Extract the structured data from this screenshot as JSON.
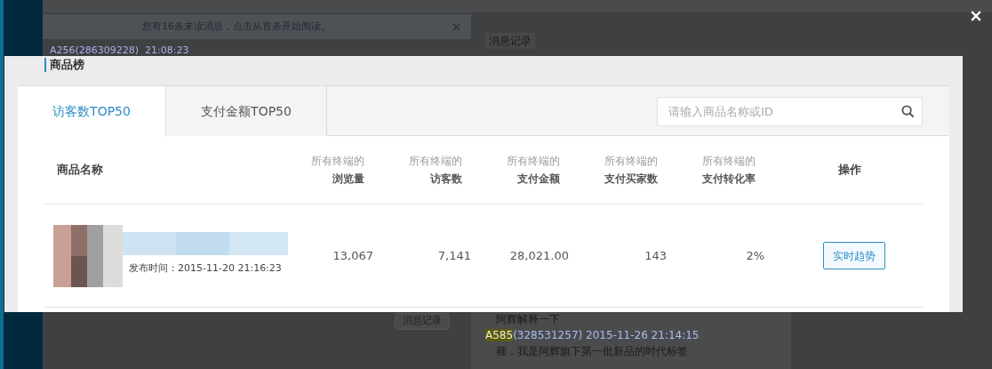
{
  "background": {
    "notice": "您有16条未读消息，点击从首条开始阅读。",
    "message_header": {
      "sender": "A256",
      "id": "(286309228)",
      "time": "21:08:23"
    },
    "side_tab": "消息记录",
    "history_button": "消息记录",
    "chat": [
      {
        "kind": "text",
        "text": "阿辉解释一下"
      },
      {
        "kind": "header",
        "sender": "A585",
        "id": "(328531257)",
        "time": "2015-11-26 21:14:15"
      },
      {
        "kind": "text",
        "text": "额，我是阿辉旗下第一批新品的时代标签"
      }
    ]
  },
  "modal": {
    "title": "商品榜",
    "tabs": [
      {
        "label": "访客数TOP50",
        "selected": true
      },
      {
        "label": "支付金额TOP50",
        "selected": false
      }
    ],
    "search": {
      "placeholder": "请输入商品名称或ID"
    },
    "columns": [
      {
        "label": "商品名称"
      },
      {
        "sub": "所有终端的",
        "label": "浏览量"
      },
      {
        "sub": "所有终端的",
        "label": "访客数"
      },
      {
        "sub": "所有终端的",
        "label": "支付金额"
      },
      {
        "sub": "所有终端的",
        "label": "支付买家数"
      },
      {
        "sub": "所有终端的",
        "label": "支付转化率"
      },
      {
        "label": "操作"
      }
    ],
    "rows": [
      {
        "cells": [
          {
            "kind": "product",
            "text": "发布时间：2015-11-20 21:16:23"
          },
          {
            "kind": "number",
            "text": "13,067"
          },
          {
            "kind": "number",
            "text": "7,141"
          },
          {
            "kind": "number",
            "text": "28,021.00"
          },
          {
            "kind": "number",
            "text": "143"
          },
          {
            "kind": "number",
            "text": "2%"
          },
          {
            "kind": "button",
            "text": "实时趋势"
          }
        ]
      }
    ]
  }
}
